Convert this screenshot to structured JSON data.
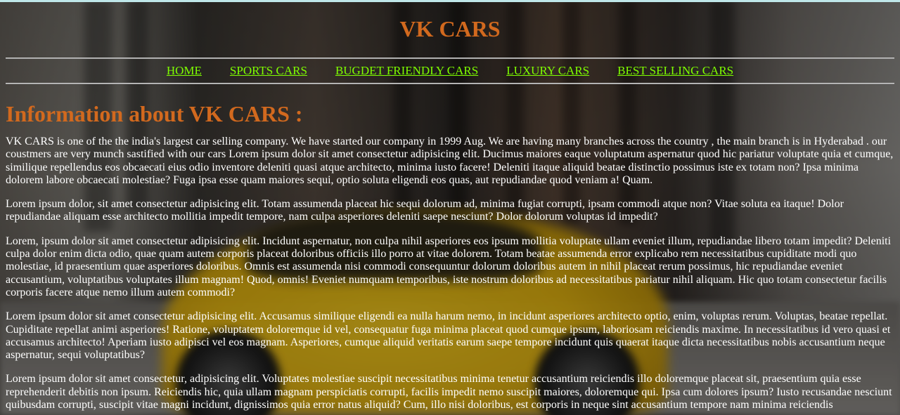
{
  "site": {
    "title": "VK CARS"
  },
  "nav": {
    "items": [
      {
        "label": "HOME"
      },
      {
        "label": "SPORTS CARS "
      },
      {
        "label": "BUGDET FRIENDLY CARS "
      },
      {
        "label": "LUXURY CARS "
      },
      {
        "label": "BEST SELLING CARS"
      }
    ]
  },
  "main": {
    "heading": "Information about VK CARS :",
    "paragraphs": [
      "VK CARS is one of the the india's largest car selling company. We have started our company in 1999 Aug. We are having many branches across the country , the main branch is in Hyderabad . our coustmers are very munch sastified with our cars Lorem ipsum dolor sit amet consectetur adipisicing elit. Ducimus maiores eaque voluptatum aspernatur quod hic pariatur voluptate quia et cumque, similique repellendus eos obcaecati eius odio inventore deleniti quasi atque architecto, minima iusto facere! Deleniti itaque aliquid beatae distinctio possimus iste ex totam non? Ipsa minima dolorem labore obcaecati molestiae? Fuga ipsa esse quam maiores sequi, optio soluta eligendi eos quas, aut repudiandae quod veniam a! Quam.",
      "Lorem ipsum dolor, sit amet consectetur adipisicing elit. Totam assumenda placeat hic sequi dolorum ad, minima fugiat corrupti, ipsam commodi atque non? Vitae soluta ea itaque! Dolor repudiandae aliquam esse architecto mollitia impedit tempore, nam culpa asperiores deleniti saepe nesciunt? Dolor dolorum voluptas id impedit?",
      "Lorem, ipsum dolor sit amet consectetur adipisicing elit. Incidunt aspernatur, non culpa nihil asperiores eos ipsum mollitia voluptate ullam eveniet illum, repudiandae libero totam impedit? Deleniti culpa dolor enim dicta odio, quae quam autem corporis placeat doloribus officiis illo porro at vitae dolorem. Totam beatae assumenda error explicabo rem necessitatibus cupiditate modi quo molestiae, id praesentium quae asperiores doloribus. Omnis est assumenda nisi commodi consequuntur dolorum doloribus autem in nihil placeat rerum possimus, hic repudiandae eveniet accusantium, voluptatibus voluptates illum magnam! Quod, omnis! Eveniet numquam temporibus, iste nostrum doloribus ad necessitatibus pariatur nihil aliquam. Hic quo totam consectetur facilis corporis facere atque nemo illum autem commodi?",
      "Lorem ipsum dolor sit amet consectetur adipisicing elit. Accusamus similique eligendi ea nulla harum nemo, in incidunt asperiores architecto optio, enim, voluptas rerum. Voluptas, beatae repellat. Cupiditate repellat animi asperiores! Ratione, voluptatem doloremque id vel, consequatur fuga minima placeat quod cumque ipsum, laboriosam reiciendis maxime. In necessitatibus id vero quasi et accusamus architecto! Aperiam iusto adipisci vel eos magnam. Asperiores, cumque aliquid veritatis earum saepe tempore incidunt quis quaerat itaque dicta necessitatibus nobis accusantium neque aspernatur, sequi voluptatibus?",
      "Lorem ipsum dolor sit amet consectetur, adipisicing elit. Voluptates molestiae suscipit necessitatibus minima tenetur accusantium reiciendis illo doloremque placeat sit, praesentium quia esse reprehenderit debitis non ipsum. Reiciendis hic, quia ullam magnam perspiciatis corrupti, facilis impedit nemo suscipit maiores, doloremque qui. Ipsa cum dolores ipsum? Iusto recusandae nesciunt quibusdam corrupti, suscipit vitae magni incidunt, dignissimos quia error natus aliquid? Cum, illo nisi doloribus, est corporis in neque sint accusantium tempore nam minima reiciendis"
    ]
  },
  "colors": {
    "title": "#d2691e",
    "nav_link": "#7fff00",
    "body_text": "#ffffff"
  }
}
